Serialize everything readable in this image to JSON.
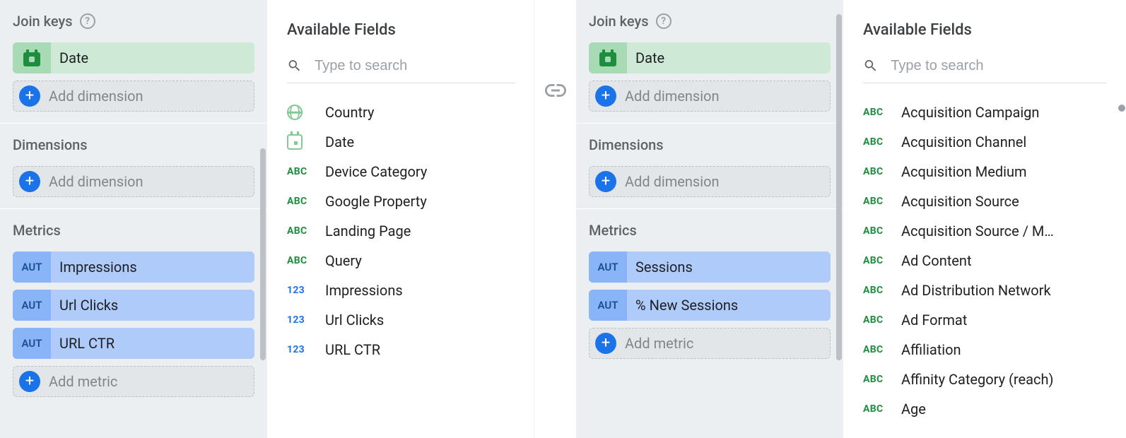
{
  "left": {
    "joinKeysLabel": "Join keys",
    "dateChip": "Date",
    "addDimension": "Add dimension",
    "dimensionsLabel": "Dimensions",
    "addDimension2": "Add dimension",
    "metricsLabel": "Metrics",
    "metricBadge": "AUT",
    "metrics": [
      "Impressions",
      "Url Clicks",
      "URL CTR"
    ],
    "addMetric": "Add metric",
    "fieldsTitle": "Available Fields",
    "searchPlaceholder": "Type to search",
    "fields": [
      {
        "t": "globe",
        "label": "Country"
      },
      {
        "t": "cal",
        "label": "Date"
      },
      {
        "t": "abc",
        "label": "Device Category"
      },
      {
        "t": "abc",
        "label": "Google Property"
      },
      {
        "t": "abc",
        "label": "Landing Page"
      },
      {
        "t": "abc",
        "label": "Query"
      },
      {
        "t": "123",
        "label": "Impressions"
      },
      {
        "t": "123",
        "label": "Url Clicks"
      },
      {
        "t": "123",
        "label": "URL CTR"
      }
    ]
  },
  "right": {
    "joinKeysLabel": "Join keys",
    "dateChip": "Date",
    "addDimension": "Add dimension",
    "dimensionsLabel": "Dimensions",
    "addDimension2": "Add dimension",
    "metricsLabel": "Metrics",
    "metricBadge": "AUT",
    "metrics": [
      "Sessions",
      "% New Sessions"
    ],
    "addMetric": "Add metric",
    "fieldsTitle": "Available Fields",
    "searchPlaceholder": "Type to search",
    "fields": [
      {
        "t": "abc",
        "label": "Acquisition Campaign"
      },
      {
        "t": "abc",
        "label": "Acquisition Channel"
      },
      {
        "t": "abc",
        "label": "Acquisition Medium"
      },
      {
        "t": "abc",
        "label": "Acquisition Source"
      },
      {
        "t": "abc",
        "label": "Acquisition Source / M…"
      },
      {
        "t": "abc",
        "label": "Ad Content"
      },
      {
        "t": "abc",
        "label": "Ad Distribution Network"
      },
      {
        "t": "abc",
        "label": "Ad Format"
      },
      {
        "t": "abc",
        "label": "Affiliation"
      },
      {
        "t": "abc",
        "label": "Affinity Category (reach)"
      },
      {
        "t": "abc",
        "label": "Age"
      }
    ]
  }
}
